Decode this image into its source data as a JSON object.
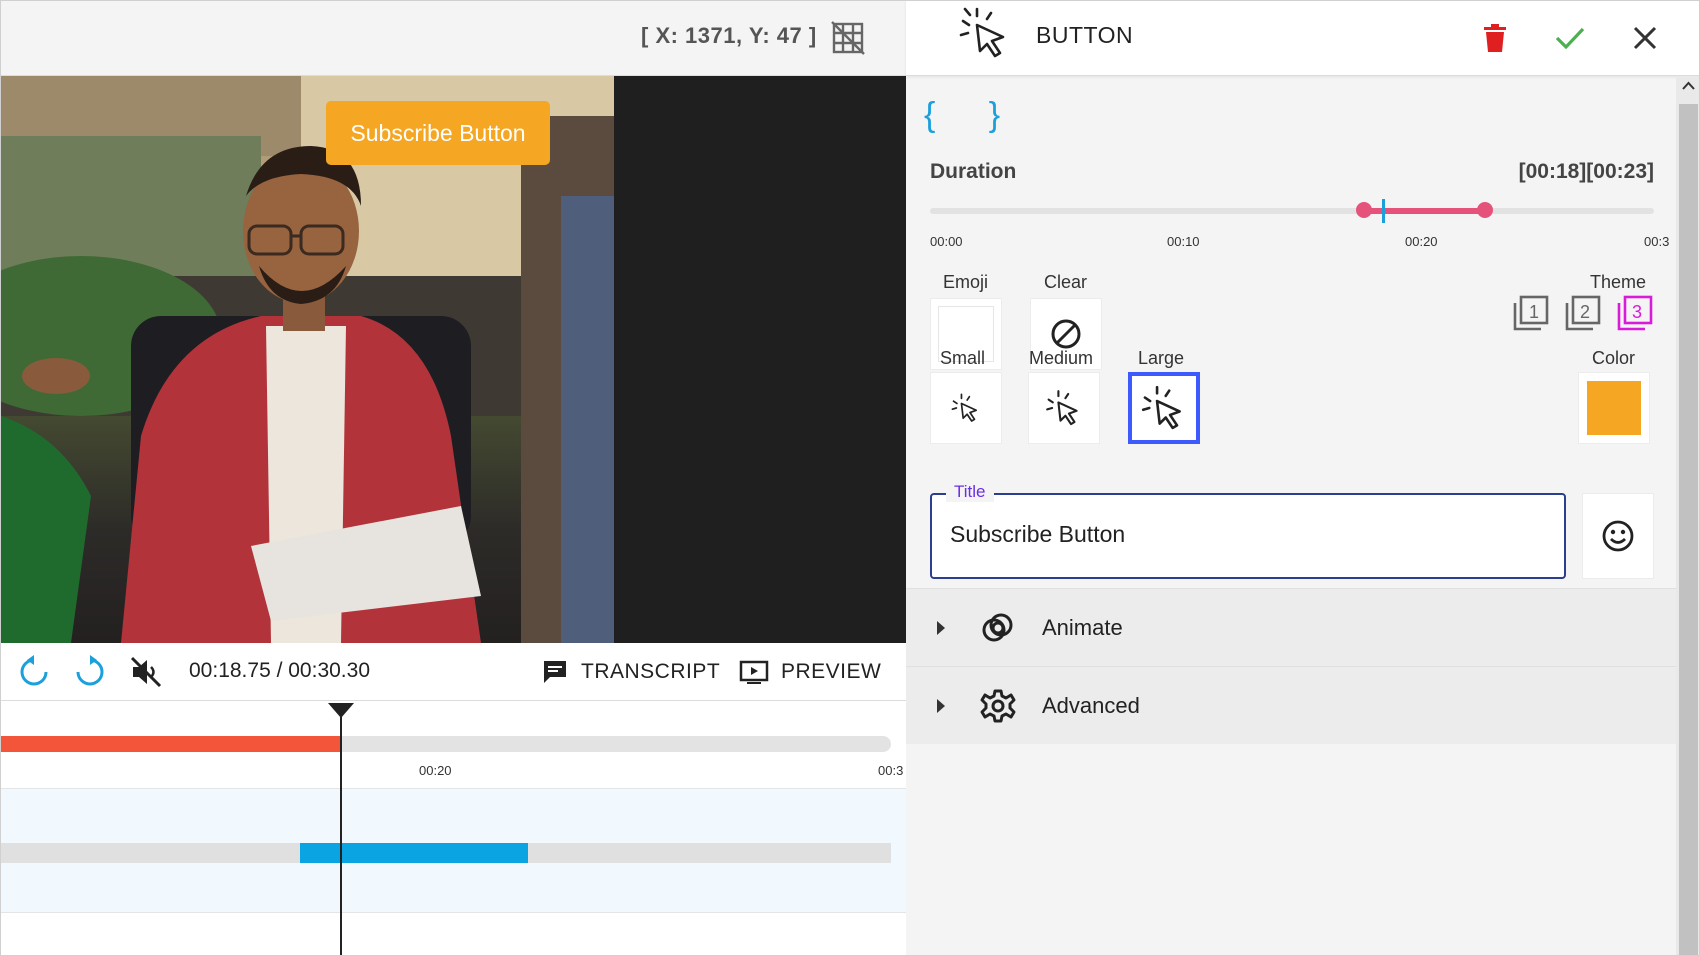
{
  "toolbar": {
    "coords_text": "[ X: 1371, Y: 47 ]",
    "grid_icon": "grid-off-icon"
  },
  "video": {
    "overlay_button_label": "Subscribe Button",
    "overlay_button_color": "#f5a623"
  },
  "player": {
    "time_readout": "00:18.75 / 00:30.30",
    "transcript_label": "TRANSCRIPT",
    "preview_label": "PREVIEW",
    "muted": true,
    "current_seconds": 18.75,
    "total_seconds": 30.3
  },
  "timeline": {
    "ticks": [
      "00:20",
      "00:3"
    ],
    "progress_color": "#f2553a",
    "clip_color": "#0aa4e3",
    "clip_start_seconds": 18,
    "clip_end_seconds": 23
  },
  "panel": {
    "header_title": "BUTTON",
    "braces": "{ }",
    "duration_label": "Duration",
    "duration_value": "[00:18][00:23]",
    "duration_ticks": [
      "00:00",
      "00:10",
      "00:20",
      "00:3"
    ],
    "duration_start": 18,
    "duration_end": 23,
    "duration_max": 30,
    "emoji_label": "Emoji",
    "clear_label": "Clear",
    "theme_label": "Theme",
    "themes": [
      "1",
      "2",
      "3"
    ],
    "selected_theme": "3",
    "small_label": "Small",
    "medium_label": "Medium",
    "large_label": "Large",
    "selected_size": "Large",
    "color_label": "Color",
    "color_value": "#f5a623",
    "title_legend": "Title",
    "title_value": "Subscribe Button",
    "accordion": [
      {
        "label": "Animate",
        "icon": "animate-rings-icon"
      },
      {
        "label": "Advanced",
        "icon": "gear-icon"
      }
    ]
  },
  "colors": {
    "accent_pink": "#e5527a",
    "accent_blue": "#1ca0dc",
    "selected_border": "#3d5afe",
    "delete_red": "#e02020",
    "confirm_green": "#4caf50",
    "theme_selected": "#d81bd8"
  }
}
